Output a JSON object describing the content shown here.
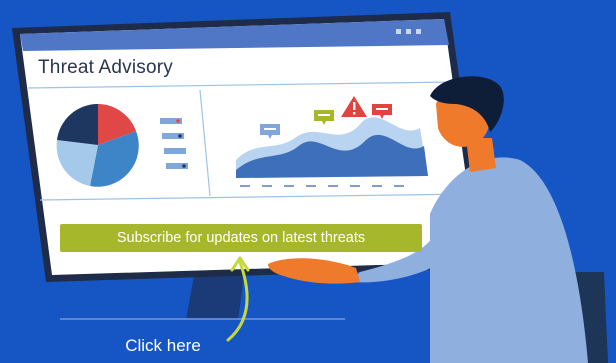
{
  "advisory": {
    "title": "Threat Advisory",
    "cta_label": "Subscribe for updates on latest threats",
    "callout": "Click here"
  },
  "colors": {
    "background": "#1656c4",
    "monitor_frame": "#1e2c4a",
    "window_header": "#4f77c6",
    "cta": "#a7b72c",
    "alert": "#e0443f",
    "pie_navy": "#1e3760",
    "pie_red": "#e04848",
    "pie_blue": "#3d85c6",
    "pie_lightblue": "#a5c9ea",
    "person_skin": "#f07a2c",
    "person_shirt": "#8fb0de",
    "chair": "#1d3658"
  },
  "icons": [
    "dots-menu-icon",
    "pie-chart-icon",
    "legend-icon",
    "chat-bubble-icon",
    "alert-triangle-icon",
    "arrow-icon"
  ]
}
